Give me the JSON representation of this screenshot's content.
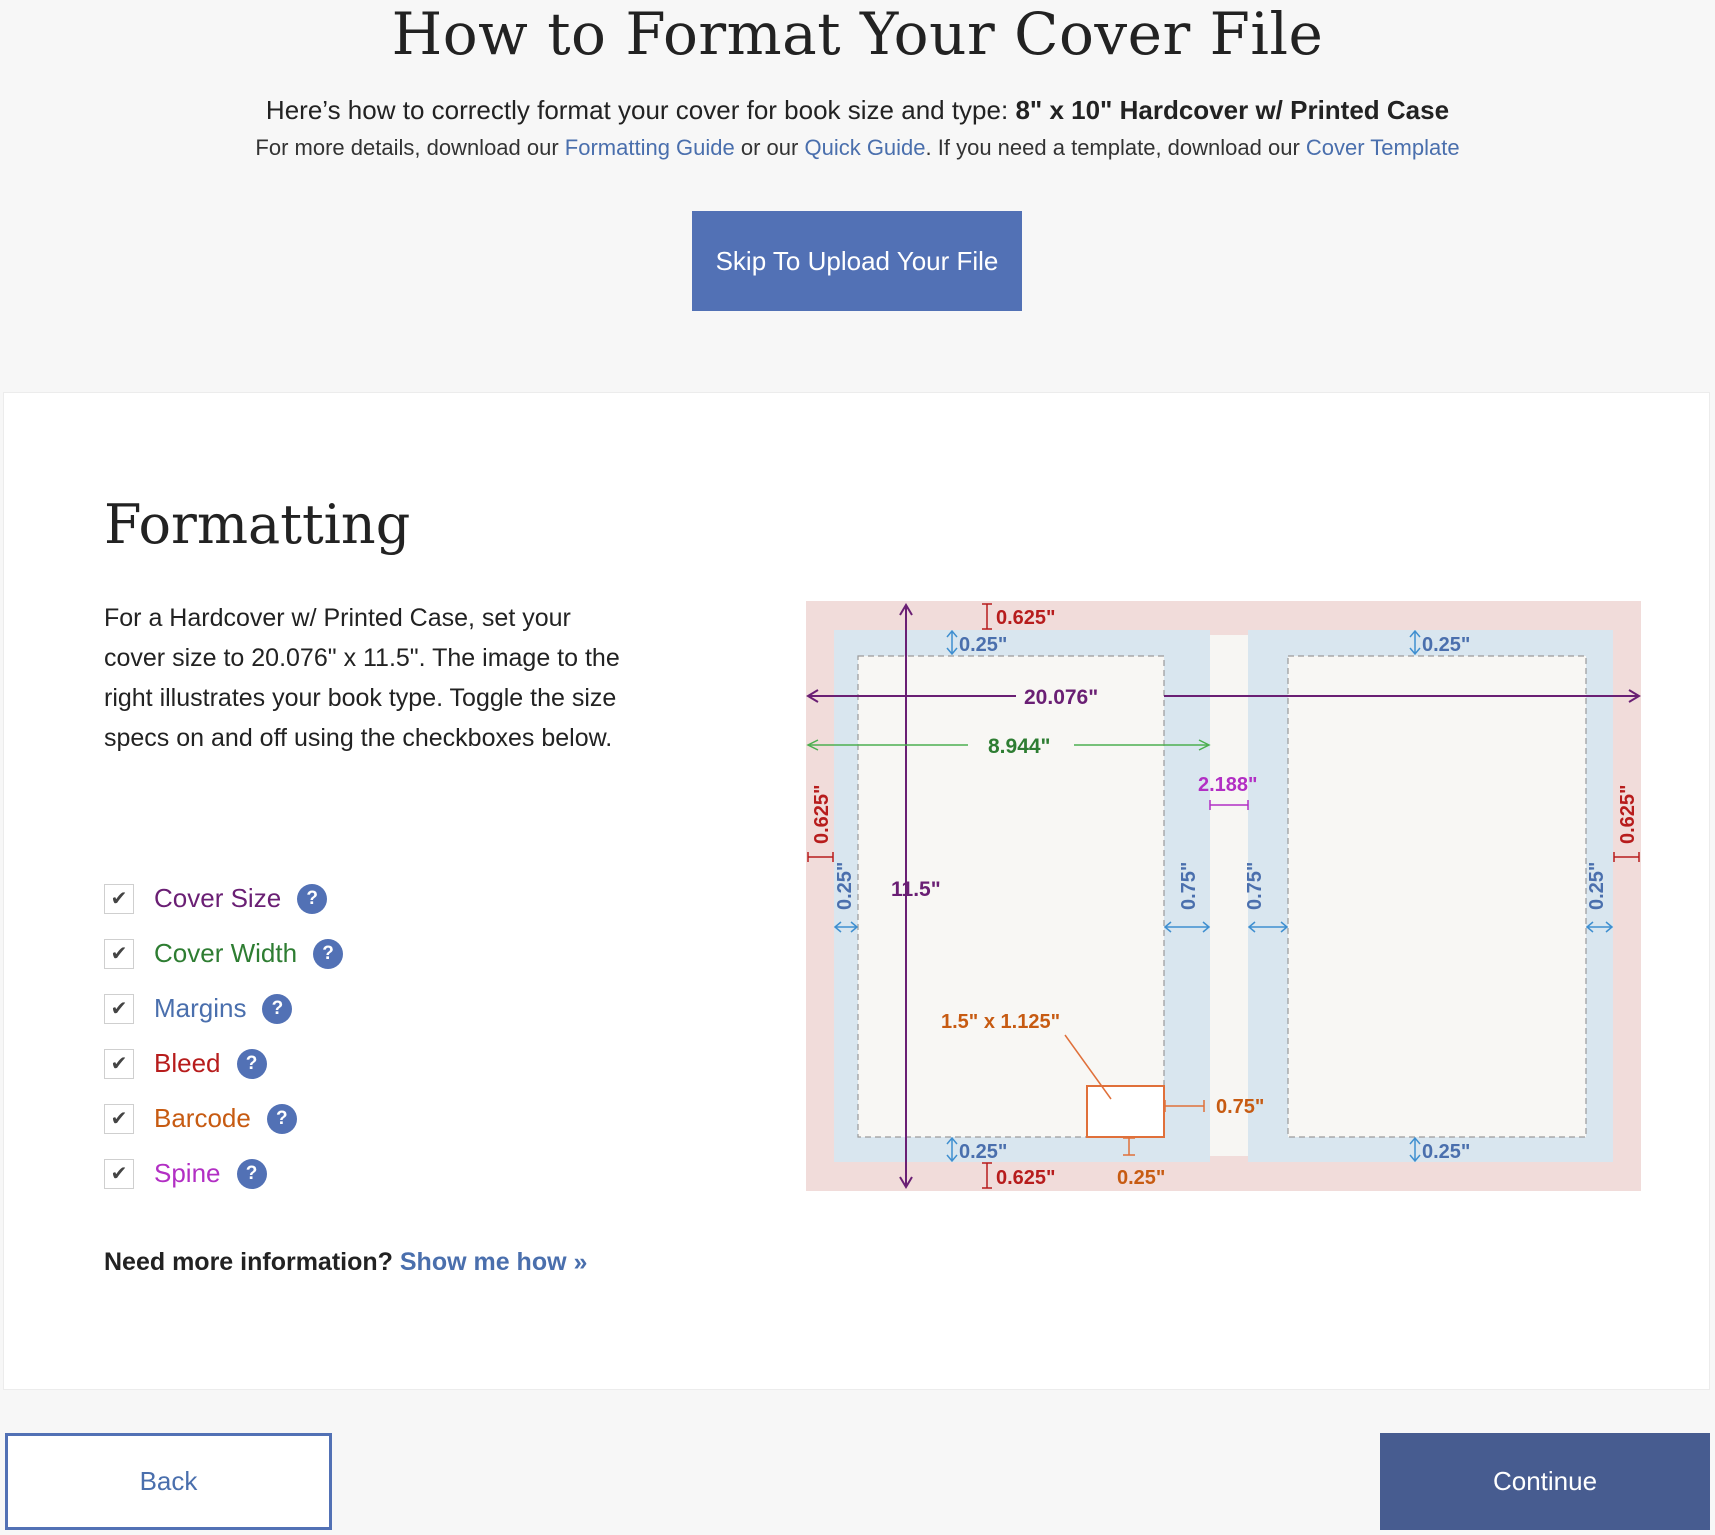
{
  "header": {
    "title": "How to Format Your Cover File",
    "subtitle_prefix": "Here’s how to correctly format your cover for book size and type: ",
    "book_type": "8\" x 10\" Hardcover w/ Printed Case",
    "details_prefix": "For more details, download our ",
    "formatting_guide_link": "Formatting Guide",
    "details_or": " or our ",
    "quick_guide_link": "Quick Guide",
    "details_template": ". If you need a template, download our ",
    "cover_template_link": "Cover Template",
    "skip_button": "Skip To Upload Your File"
  },
  "formatting": {
    "title": "Formatting",
    "description": "For a Hardcover w/ Printed Case, set your cover size to 20.076\" x 11.5\". The image to the right illustrates your book type. Toggle the size specs on and off using the checkboxes below.",
    "toggles": [
      {
        "label": "Cover Size",
        "checked": true,
        "color": "#6a1f74"
      },
      {
        "label": "Cover Width",
        "checked": true,
        "color": "#2e7d32"
      },
      {
        "label": "Margins",
        "checked": true,
        "color": "#4a6fad"
      },
      {
        "label": "Bleed",
        "checked": true,
        "color": "#b71c1c"
      },
      {
        "label": "Barcode",
        "checked": true,
        "color": "#c75b12"
      },
      {
        "label": "Spine",
        "checked": true,
        "color": "#b22fc4"
      }
    ],
    "check_glyph": "✔",
    "help_glyph": "?",
    "more_prefix": "Need more information? ",
    "more_link": "Show me how »"
  },
  "diagram": {
    "bleed_top": "0.625\"",
    "bleed_bottom": "0.625\"",
    "bleed_left": "0.625\"",
    "bleed_right": "0.625\"",
    "margin_top_front": "0.25\"",
    "margin_top_back": "0.25\"",
    "margin_bottom_front": "0.25\"",
    "margin_bottom_back": "0.25\"",
    "margin_left": "0.25\"",
    "margin_right": "0.25\"",
    "margin_spine_left": "0.75\"",
    "margin_spine_right": "0.75\"",
    "cover_width_total": "20.076\"",
    "cover_height": "11.5\"",
    "panel_width": "8.944\"",
    "spine_width": "2.188\"",
    "barcode_size": "1.5\" x 1.125\"",
    "barcode_right_offset": "0.75\"",
    "barcode_bottom_offset": "0.25\""
  },
  "footer": {
    "back_button": "Back",
    "continue_button": "Continue"
  }
}
